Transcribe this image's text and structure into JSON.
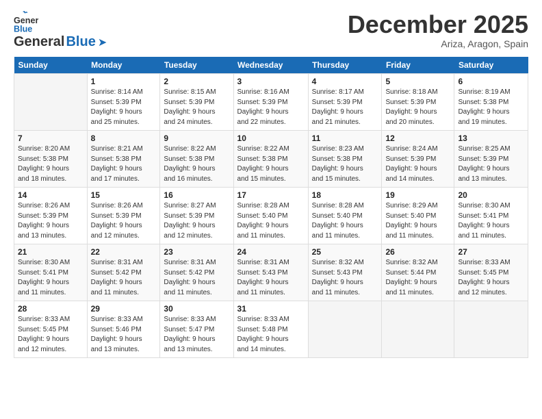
{
  "header": {
    "logo_general": "General",
    "logo_blue": "Blue",
    "month": "December 2025",
    "location": "Ariza, Aragon, Spain"
  },
  "weekdays": [
    "Sunday",
    "Monday",
    "Tuesday",
    "Wednesday",
    "Thursday",
    "Friday",
    "Saturday"
  ],
  "weeks": [
    [
      {
        "day": "",
        "info": ""
      },
      {
        "day": "1",
        "info": "Sunrise: 8:14 AM\nSunset: 5:39 PM\nDaylight: 9 hours\nand 25 minutes."
      },
      {
        "day": "2",
        "info": "Sunrise: 8:15 AM\nSunset: 5:39 PM\nDaylight: 9 hours\nand 24 minutes."
      },
      {
        "day": "3",
        "info": "Sunrise: 8:16 AM\nSunset: 5:39 PM\nDaylight: 9 hours\nand 22 minutes."
      },
      {
        "day": "4",
        "info": "Sunrise: 8:17 AM\nSunset: 5:39 PM\nDaylight: 9 hours\nand 21 minutes."
      },
      {
        "day": "5",
        "info": "Sunrise: 8:18 AM\nSunset: 5:39 PM\nDaylight: 9 hours\nand 20 minutes."
      },
      {
        "day": "6",
        "info": "Sunrise: 8:19 AM\nSunset: 5:38 PM\nDaylight: 9 hours\nand 19 minutes."
      }
    ],
    [
      {
        "day": "7",
        "info": "Sunrise: 8:20 AM\nSunset: 5:38 PM\nDaylight: 9 hours\nand 18 minutes."
      },
      {
        "day": "8",
        "info": "Sunrise: 8:21 AM\nSunset: 5:38 PM\nDaylight: 9 hours\nand 17 minutes."
      },
      {
        "day": "9",
        "info": "Sunrise: 8:22 AM\nSunset: 5:38 PM\nDaylight: 9 hours\nand 16 minutes."
      },
      {
        "day": "10",
        "info": "Sunrise: 8:22 AM\nSunset: 5:38 PM\nDaylight: 9 hours\nand 15 minutes."
      },
      {
        "day": "11",
        "info": "Sunrise: 8:23 AM\nSunset: 5:38 PM\nDaylight: 9 hours\nand 15 minutes."
      },
      {
        "day": "12",
        "info": "Sunrise: 8:24 AM\nSunset: 5:39 PM\nDaylight: 9 hours\nand 14 minutes."
      },
      {
        "day": "13",
        "info": "Sunrise: 8:25 AM\nSunset: 5:39 PM\nDaylight: 9 hours\nand 13 minutes."
      }
    ],
    [
      {
        "day": "14",
        "info": "Sunrise: 8:26 AM\nSunset: 5:39 PM\nDaylight: 9 hours\nand 13 minutes."
      },
      {
        "day": "15",
        "info": "Sunrise: 8:26 AM\nSunset: 5:39 PM\nDaylight: 9 hours\nand 12 minutes."
      },
      {
        "day": "16",
        "info": "Sunrise: 8:27 AM\nSunset: 5:39 PM\nDaylight: 9 hours\nand 12 minutes."
      },
      {
        "day": "17",
        "info": "Sunrise: 8:28 AM\nSunset: 5:40 PM\nDaylight: 9 hours\nand 11 minutes."
      },
      {
        "day": "18",
        "info": "Sunrise: 8:28 AM\nSunset: 5:40 PM\nDaylight: 9 hours\nand 11 minutes."
      },
      {
        "day": "19",
        "info": "Sunrise: 8:29 AM\nSunset: 5:40 PM\nDaylight: 9 hours\nand 11 minutes."
      },
      {
        "day": "20",
        "info": "Sunrise: 8:30 AM\nSunset: 5:41 PM\nDaylight: 9 hours\nand 11 minutes."
      }
    ],
    [
      {
        "day": "21",
        "info": "Sunrise: 8:30 AM\nSunset: 5:41 PM\nDaylight: 9 hours\nand 11 minutes."
      },
      {
        "day": "22",
        "info": "Sunrise: 8:31 AM\nSunset: 5:42 PM\nDaylight: 9 hours\nand 11 minutes."
      },
      {
        "day": "23",
        "info": "Sunrise: 8:31 AM\nSunset: 5:42 PM\nDaylight: 9 hours\nand 11 minutes."
      },
      {
        "day": "24",
        "info": "Sunrise: 8:31 AM\nSunset: 5:43 PM\nDaylight: 9 hours\nand 11 minutes."
      },
      {
        "day": "25",
        "info": "Sunrise: 8:32 AM\nSunset: 5:43 PM\nDaylight: 9 hours\nand 11 minutes."
      },
      {
        "day": "26",
        "info": "Sunrise: 8:32 AM\nSunset: 5:44 PM\nDaylight: 9 hours\nand 11 minutes."
      },
      {
        "day": "27",
        "info": "Sunrise: 8:33 AM\nSunset: 5:45 PM\nDaylight: 9 hours\nand 12 minutes."
      }
    ],
    [
      {
        "day": "28",
        "info": "Sunrise: 8:33 AM\nSunset: 5:45 PM\nDaylight: 9 hours\nand 12 minutes."
      },
      {
        "day": "29",
        "info": "Sunrise: 8:33 AM\nSunset: 5:46 PM\nDaylight: 9 hours\nand 13 minutes."
      },
      {
        "day": "30",
        "info": "Sunrise: 8:33 AM\nSunset: 5:47 PM\nDaylight: 9 hours\nand 13 minutes."
      },
      {
        "day": "31",
        "info": "Sunrise: 8:33 AM\nSunset: 5:48 PM\nDaylight: 9 hours\nand 14 minutes."
      },
      {
        "day": "",
        "info": ""
      },
      {
        "day": "",
        "info": ""
      },
      {
        "day": "",
        "info": ""
      }
    ]
  ]
}
